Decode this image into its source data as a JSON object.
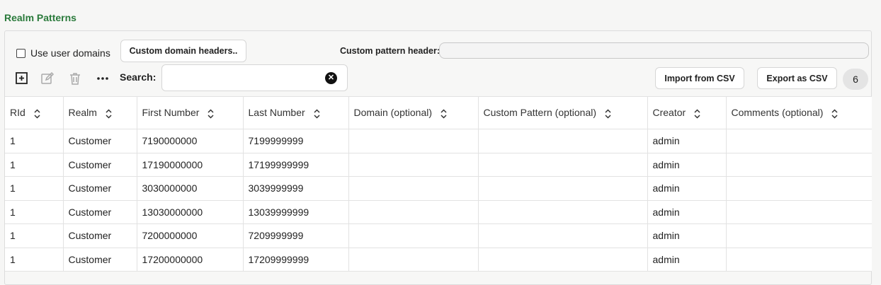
{
  "title": "Realm Patterns",
  "options": {
    "use_user_domains_label": "Use user domains",
    "custom_domain_headers_label": "Custom domain headers..",
    "custom_pattern_header_label": "Custom pattern header:",
    "custom_pattern_header_value": ""
  },
  "toolbar": {
    "add_icon": "plus-square-icon",
    "edit_icon": "pencil-icon",
    "delete_icon": "trash-icon",
    "more_icon": "ellipsis-icon",
    "search_label": "Search:",
    "search_value": "",
    "import_label": "Import from CSV",
    "export_label": "Export as CSV",
    "count": "6"
  },
  "table": {
    "columns": [
      "RId",
      "Realm",
      "First Number",
      "Last Number",
      "Domain (optional)",
      "Custom Pattern (optional)",
      "Creator",
      "Comments (optional)"
    ],
    "rows": [
      [
        "1",
        "Customer",
        "7190000000",
        "7199999999",
        "",
        "",
        "admin",
        ""
      ],
      [
        "1",
        "Customer",
        "17190000000",
        "17199999999",
        "",
        "",
        "admin",
        ""
      ],
      [
        "1",
        "Customer",
        "3030000000",
        "3039999999",
        "",
        "",
        "admin",
        ""
      ],
      [
        "1",
        "Customer",
        "13030000000",
        "13039999999",
        "",
        "",
        "admin",
        ""
      ],
      [
        "1",
        "Customer",
        "7200000000",
        "7209999999",
        "",
        "",
        "admin",
        ""
      ],
      [
        "1",
        "Customer",
        "17200000000",
        "17209999999",
        "",
        "",
        "admin",
        ""
      ]
    ]
  }
}
